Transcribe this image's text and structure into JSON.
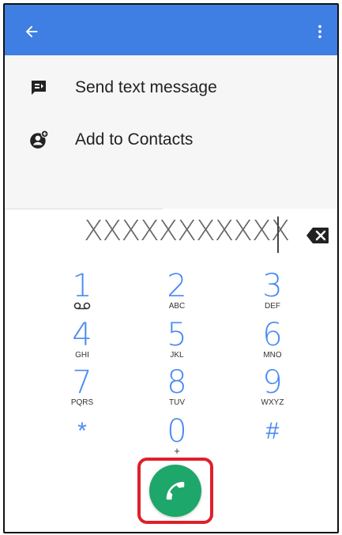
{
  "header": {
    "back_icon": "arrow-left-icon",
    "more_icon": "more-vert-icon",
    "color": "#3f7fe3"
  },
  "suggestions": [
    {
      "label": "Send text message",
      "icon": "message-icon"
    },
    {
      "label": "Add to Contacts",
      "icon": "add-contact-icon"
    }
  ],
  "dialer": {
    "number": "XXXXXXXXXXX",
    "backspace_icon": "backspace-icon",
    "keys": [
      {
        "digit": "1",
        "letters": "",
        "extra_icon": "voicemail-icon"
      },
      {
        "digit": "2",
        "letters": "ABC"
      },
      {
        "digit": "3",
        "letters": "DEF"
      },
      {
        "digit": "4",
        "letters": "GHI"
      },
      {
        "digit": "5",
        "letters": "JKL"
      },
      {
        "digit": "6",
        "letters": "MNO"
      },
      {
        "digit": "7",
        "letters": "PQRS"
      },
      {
        "digit": "8",
        "letters": "TUV"
      },
      {
        "digit": "9",
        "letters": "WXYZ"
      },
      {
        "digit": "*",
        "letters": ""
      },
      {
        "digit": "0",
        "letters": "+"
      },
      {
        "digit": "#",
        "letters": ""
      }
    ],
    "call_icon": "phone-icon",
    "call_color": "#1da76a",
    "highlight_color": "#e01f2a"
  }
}
